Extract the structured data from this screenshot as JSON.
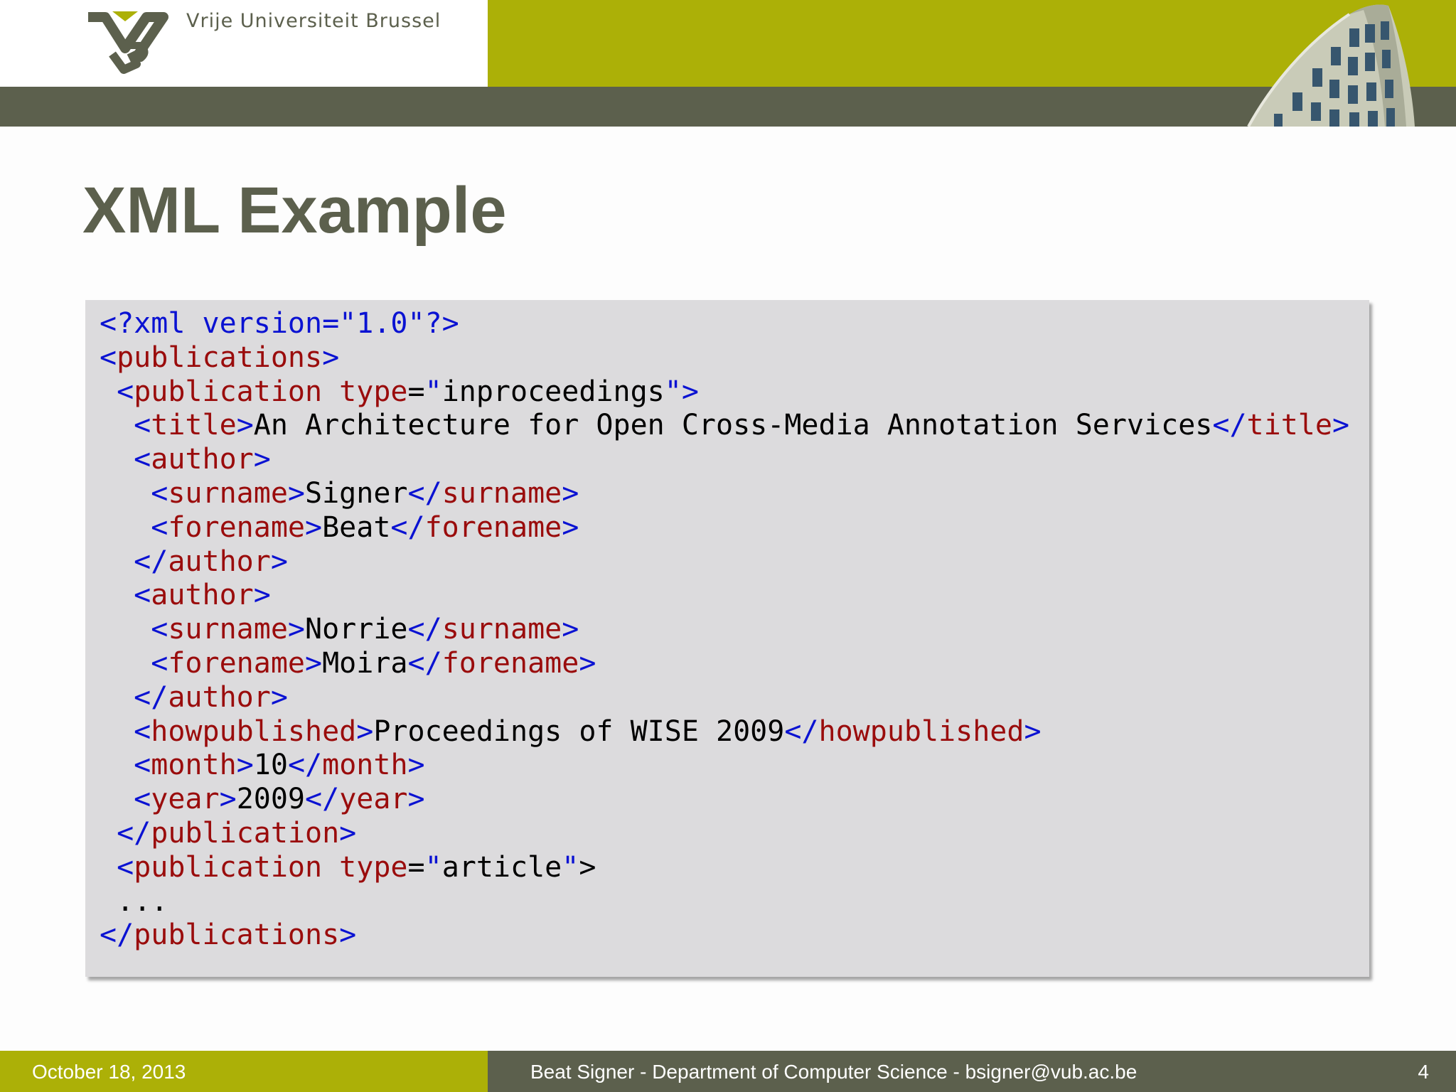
{
  "header": {
    "university": "Vrije Universiteit  Brussel",
    "logo_icon": "vub-logo-icon",
    "photo": "building-photo",
    "colors": {
      "lime": "#acb007",
      "dark": "#5c604d"
    }
  },
  "title": "XML Example",
  "code": {
    "colors": {
      "markup": "#0a12d2",
      "name": "#9a0c0c",
      "text": "#000000",
      "background": "#dcdbdd"
    },
    "lines": [
      [
        [
          "b",
          "<?xml version=\"1.0\"?>"
        ]
      ],
      [
        [
          "b",
          "<"
        ],
        [
          "r",
          "publications"
        ],
        [
          "b",
          ">"
        ]
      ],
      [
        [
          "k",
          " "
        ],
        [
          "b",
          "<"
        ],
        [
          "r",
          "publication type"
        ],
        [
          "k",
          "="
        ],
        [
          "b",
          "\""
        ],
        [
          "k",
          "inproceedings"
        ],
        [
          "b",
          "\">"
        ]
      ],
      [
        [
          "k",
          "  "
        ],
        [
          "b",
          "<"
        ],
        [
          "r",
          "title"
        ],
        [
          "b",
          ">"
        ],
        [
          "k",
          "An Architecture for Open Cross-Media Annotation Services"
        ],
        [
          "b",
          "</"
        ],
        [
          "r",
          "title"
        ],
        [
          "b",
          ">"
        ]
      ],
      [
        [
          "k",
          "  "
        ],
        [
          "b",
          "<"
        ],
        [
          "r",
          "author"
        ],
        [
          "b",
          ">"
        ]
      ],
      [
        [
          "k",
          "   "
        ],
        [
          "b",
          "<"
        ],
        [
          "r",
          "surname"
        ],
        [
          "b",
          ">"
        ],
        [
          "k",
          "Signer"
        ],
        [
          "b",
          "</"
        ],
        [
          "r",
          "surname"
        ],
        [
          "b",
          ">"
        ]
      ],
      [
        [
          "k",
          "   "
        ],
        [
          "b",
          "<"
        ],
        [
          "r",
          "forename"
        ],
        [
          "b",
          ">"
        ],
        [
          "k",
          "Beat"
        ],
        [
          "b",
          "</"
        ],
        [
          "r",
          "forename"
        ],
        [
          "b",
          ">"
        ]
      ],
      [
        [
          "k",
          "  "
        ],
        [
          "b",
          "</"
        ],
        [
          "r",
          "author"
        ],
        [
          "b",
          ">"
        ]
      ],
      [
        [
          "k",
          "  "
        ],
        [
          "b",
          "<"
        ],
        [
          "r",
          "author"
        ],
        [
          "b",
          ">"
        ]
      ],
      [
        [
          "k",
          "   "
        ],
        [
          "b",
          "<"
        ],
        [
          "r",
          "surname"
        ],
        [
          "b",
          ">"
        ],
        [
          "k",
          "Norrie"
        ],
        [
          "b",
          "</"
        ],
        [
          "r",
          "surname"
        ],
        [
          "b",
          ">"
        ]
      ],
      [
        [
          "k",
          "   "
        ],
        [
          "b",
          "<"
        ],
        [
          "r",
          "forename"
        ],
        [
          "b",
          ">"
        ],
        [
          "k",
          "Moira"
        ],
        [
          "b",
          "</"
        ],
        [
          "r",
          "forename"
        ],
        [
          "b",
          ">"
        ]
      ],
      [
        [
          "k",
          "  "
        ],
        [
          "b",
          "</"
        ],
        [
          "r",
          "author"
        ],
        [
          "b",
          ">"
        ]
      ],
      [
        [
          "k",
          "  "
        ],
        [
          "b",
          "<"
        ],
        [
          "r",
          "howpublished"
        ],
        [
          "b",
          ">"
        ],
        [
          "k",
          "Proceedings of WISE 2009"
        ],
        [
          "b",
          "</"
        ],
        [
          "r",
          "howpublished"
        ],
        [
          "b",
          ">"
        ]
      ],
      [
        [
          "k",
          "  "
        ],
        [
          "b",
          "<"
        ],
        [
          "r",
          "month"
        ],
        [
          "b",
          ">"
        ],
        [
          "k",
          "10"
        ],
        [
          "b",
          "</"
        ],
        [
          "r",
          "month"
        ],
        [
          "b",
          ">"
        ]
      ],
      [
        [
          "k",
          "  "
        ],
        [
          "b",
          "<"
        ],
        [
          "r",
          "year"
        ],
        [
          "b",
          ">"
        ],
        [
          "k",
          "2009"
        ],
        [
          "b",
          "</"
        ],
        [
          "r",
          "year"
        ],
        [
          "b",
          ">"
        ]
      ],
      [
        [
          "k",
          " "
        ],
        [
          "b",
          "</"
        ],
        [
          "r",
          "publication"
        ],
        [
          "b",
          ">"
        ]
      ],
      [
        [
          "k",
          " "
        ],
        [
          "b",
          "<"
        ],
        [
          "r",
          "publication type"
        ],
        [
          "k",
          "="
        ],
        [
          "b",
          "\""
        ],
        [
          "k",
          "article"
        ],
        [
          "b",
          "\""
        ],
        [
          "k",
          ">"
        ]
      ],
      [
        [
          "k",
          " ..."
        ]
      ],
      [
        [
          "b",
          "</"
        ],
        [
          "r",
          "publications"
        ],
        [
          "b",
          ">"
        ]
      ]
    ]
  },
  "footer": {
    "date": "October 18, 2013",
    "center": "Beat Signer - Department of Computer Science - bsigner@vub.ac.be",
    "page": "4"
  }
}
